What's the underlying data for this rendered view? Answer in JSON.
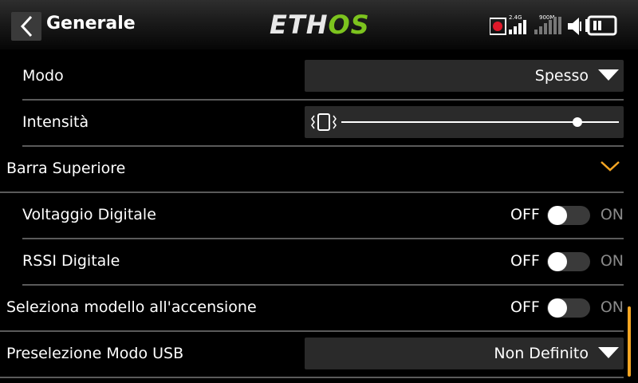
{
  "header": {
    "title": "Generale",
    "logo_main": "ETH",
    "logo_accent": "OS",
    "logo_color": "#7cc31e",
    "status": {
      "rx_label": "2.4G",
      "rx2_label": "900M",
      "icons": [
        "record-icon",
        "signal-24g-icon",
        "signal-900m-icon",
        "volume-muted-icon",
        "battery-icon"
      ]
    }
  },
  "rows": [
    {
      "label": "Modo",
      "type": "dropdown",
      "value": "Spesso"
    },
    {
      "label": "Intensità",
      "type": "slider",
      "level": 0.85
    },
    {
      "label": "Barra Superiore",
      "type": "section",
      "expanded": true
    },
    {
      "label": "Voltaggio Digitale",
      "type": "toggle",
      "state": "OFF"
    },
    {
      "label": "RSSI Digitale",
      "type": "toggle",
      "state": "OFF"
    },
    {
      "label": "Seleziona modello all'accensione",
      "type": "toggle",
      "state": "OFF"
    },
    {
      "label": "Preselezione Modo USB",
      "type": "dropdown",
      "value": "Non Definito"
    }
  ],
  "toggle_labels": {
    "off": "OFF",
    "on": "ON"
  },
  "accent_color": "#f5a623"
}
